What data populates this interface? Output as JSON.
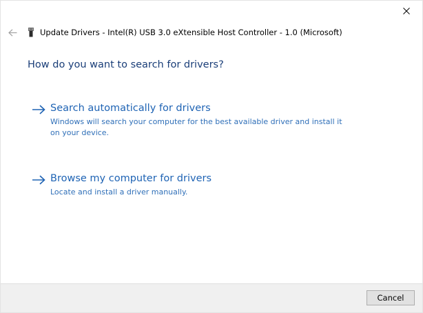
{
  "window": {
    "title": "Update Drivers - Intel(R) USB 3.0 eXtensible Host Controller - 1.0 (Microsoft)",
    "close_icon": "close-icon",
    "back_icon": "back-arrow-icon",
    "device_icon": "usb-device-icon"
  },
  "main": {
    "heading": "How do you want to search for drivers?",
    "options": [
      {
        "icon": "arrow-right-icon",
        "title": "Search automatically for drivers",
        "description": "Windows will search your computer for the best available driver and install it on your device."
      },
      {
        "icon": "arrow-right-icon",
        "title": "Browse my computer for drivers",
        "description": "Locate and install a driver manually."
      }
    ]
  },
  "footer": {
    "cancel_label": "Cancel"
  },
  "colors": {
    "heading": "#1a3e78",
    "link": "#1e63b4",
    "footer_bg": "#f0f0f0"
  }
}
